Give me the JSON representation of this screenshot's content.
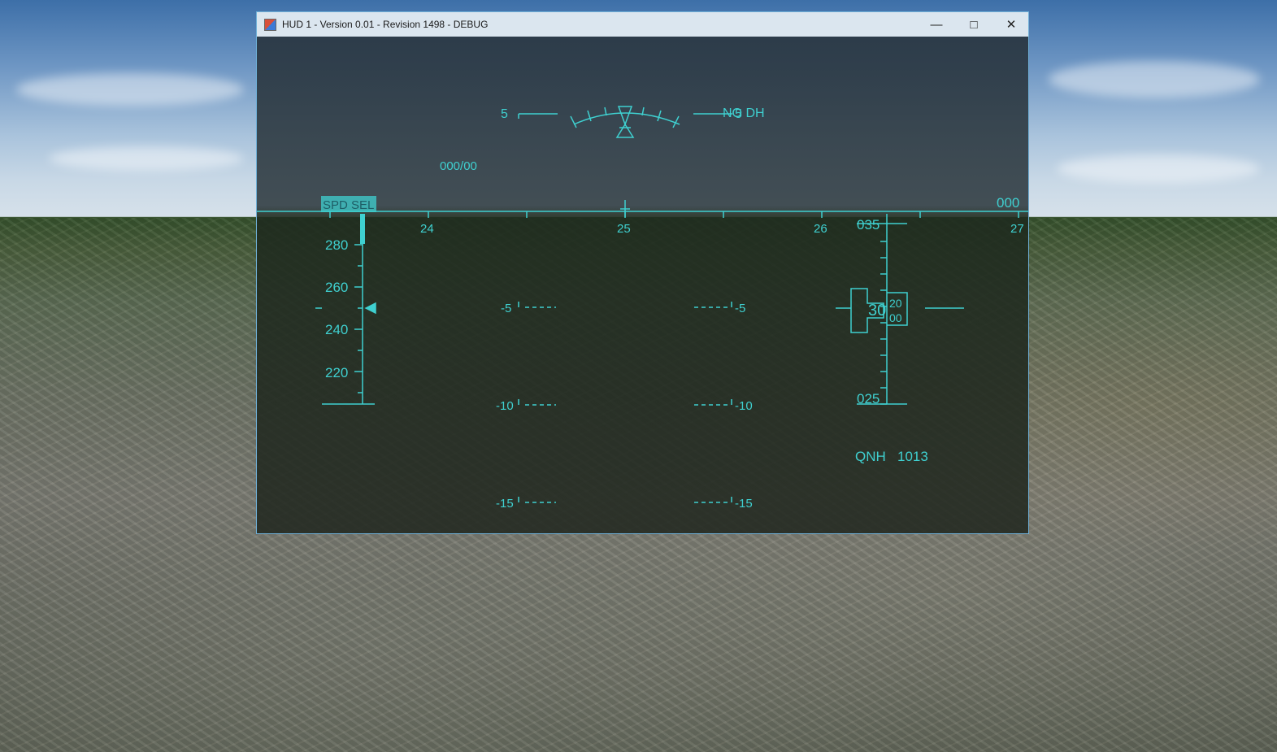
{
  "window": {
    "title": "HUD 1 - Version 0.01 - Revision 1498 - DEBUG",
    "minimize_glyph": "—",
    "maximize_glyph": "□",
    "close_glyph": "✕"
  },
  "hud": {
    "color": "#3fd0d0",
    "bank_label_left": "5",
    "bank_label_right": "5",
    "dh_label": "NO DH",
    "wind": "000/00",
    "speed_mode": "SPD SEL",
    "heading_readout": "000",
    "heading_ticks": [
      "24",
      "25",
      "26",
      "27"
    ],
    "speed_ticks": [
      "280",
      "260",
      "240",
      "220"
    ],
    "altitude_top": "035",
    "altitude_bottom": "025",
    "altitude_readout_main": "30",
    "altitude_readout_fine_top": "20",
    "altitude_readout_fine_bottom": "00",
    "pitch_labels_left": [
      "-5",
      "-10",
      "-15"
    ],
    "pitch_labels_right": [
      "-5",
      "-10",
      "-15"
    ],
    "qnh_label": "QNH",
    "qnh_value": "1013"
  }
}
